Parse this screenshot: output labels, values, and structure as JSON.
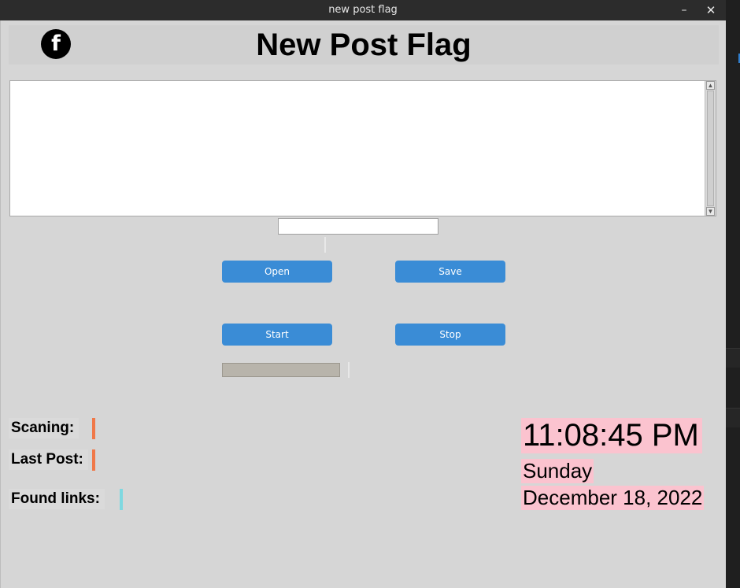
{
  "window": {
    "title": "new post flag",
    "minimize_glyph": "–",
    "close_glyph": "✕"
  },
  "header": {
    "logo_icon": "facebook-icon",
    "logo_glyph": "f",
    "title": "New Post Flag"
  },
  "editor": {
    "value": "",
    "scroll_up_glyph": "▲",
    "scroll_down_glyph": "▼"
  },
  "small_entry": {
    "value": ""
  },
  "buttons": {
    "open": "Open",
    "save": "Save",
    "start": "Start",
    "stop": "Stop"
  },
  "progress": {
    "value_percent": 0
  },
  "status": {
    "scanning_label": "Scaning:",
    "last_post_label": "Last Post:",
    "found_links_label": "Found links:",
    "scanning_indicator_color": "#f07848",
    "last_post_indicator_color": "#f07848",
    "found_links_indicator_color": "#7fd8e0"
  },
  "clock": {
    "time": "11:08:45 PM",
    "day": "Sunday",
    "date": "December 18, 2022",
    "background_color": "#fbc3cf"
  }
}
